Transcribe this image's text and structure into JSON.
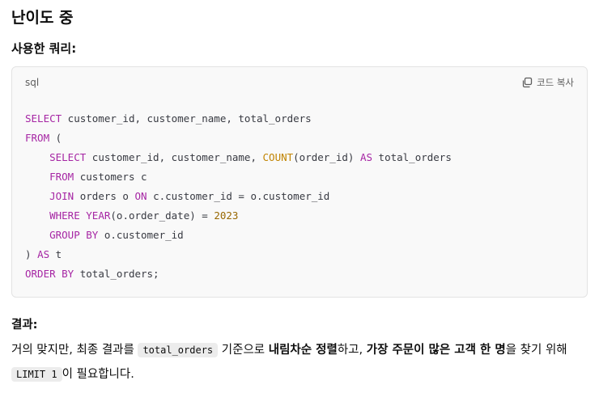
{
  "heading": "난이도 중",
  "query_label": "사용한 쿼리:",
  "code_block": {
    "language": "sql",
    "copy_label": "코드 복사",
    "lines": [
      [
        [
          "kw",
          "SELECT"
        ],
        [
          "p",
          " customer_id, customer_name, total_orders"
        ]
      ],
      [
        [
          "kw",
          "FROM"
        ],
        [
          "p",
          " ("
        ]
      ],
      [
        [
          "p",
          "    "
        ],
        [
          "kw",
          "SELECT"
        ],
        [
          "p",
          " customer_id, customer_name, "
        ],
        [
          "fn",
          "COUNT"
        ],
        [
          "p",
          "(order_id) "
        ],
        [
          "kw",
          "AS"
        ],
        [
          "p",
          " total_orders"
        ]
      ],
      [
        [
          "p",
          "    "
        ],
        [
          "kw",
          "FROM"
        ],
        [
          "p",
          " customers c"
        ]
      ],
      [
        [
          "p",
          "    "
        ],
        [
          "kw",
          "JOIN"
        ],
        [
          "p",
          " orders o "
        ],
        [
          "kw",
          "ON"
        ],
        [
          "p",
          " c.customer_id = o.customer_id"
        ]
      ],
      [
        [
          "p",
          "    "
        ],
        [
          "kw",
          "WHERE"
        ],
        [
          "p",
          " "
        ],
        [
          "kw",
          "YEAR"
        ],
        [
          "p",
          "(o.order_date) = "
        ],
        [
          "num",
          "2023"
        ]
      ],
      [
        [
          "p",
          "    "
        ],
        [
          "kw",
          "GROUP BY"
        ],
        [
          "p",
          " o.customer_id"
        ]
      ],
      [
        [
          "p",
          ") "
        ],
        [
          "kw",
          "AS"
        ],
        [
          "p",
          " t"
        ]
      ],
      [
        [
          "kw",
          "ORDER BY"
        ],
        [
          "p",
          " total_orders;"
        ]
      ]
    ]
  },
  "result_label": "결과:",
  "result_text": {
    "part1": "거의 맞지만, 최종 결과를 ",
    "code1": "total_orders",
    "part2": " 기준으로 ",
    "bold1": "내림차순 정렬",
    "part3": "하고, ",
    "bold2": "가장 주문이 많은 고객 한 명",
    "part4": "을 찾기 위해 ",
    "code2": "LIMIT 1",
    "part5": "이 필요합니다."
  }
}
